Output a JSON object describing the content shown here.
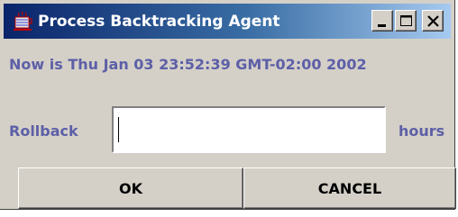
{
  "window": {
    "title": "Process Backtracking Agent",
    "icon": "java-cup-icon",
    "controls": [
      "minimize-icon",
      "maximize-icon",
      "close-icon"
    ]
  },
  "body": {
    "now_text": "Now is Thu Jan 03 23:52:39 GMT-02:00 2002",
    "rollback_label": "Rollback",
    "rollback_value": "",
    "hours_label": "hours"
  },
  "buttons": {
    "ok_label": "OK",
    "cancel_label": "CANCEL"
  },
  "colors": {
    "label_text": "#5d5fa7",
    "title_bar_start": "#0a246a",
    "title_bar_end": "#a6caf0",
    "window_bg": "#d4d0c8"
  }
}
